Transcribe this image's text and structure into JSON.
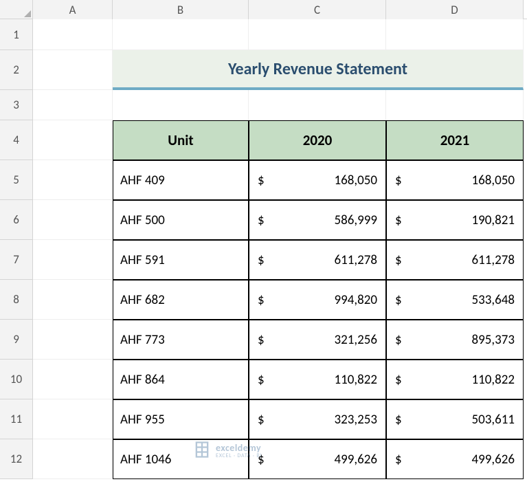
{
  "columns": [
    "A",
    "B",
    "C",
    "D"
  ],
  "rows": [
    "1",
    "2",
    "3",
    "4",
    "5",
    "6",
    "7",
    "8",
    "9",
    "10",
    "11",
    "12"
  ],
  "title": "Yearly Revenue Statement",
  "headers": {
    "unit": "Unit",
    "y1": "2020",
    "y2": "2021"
  },
  "data": [
    {
      "unit": "AHF 409",
      "y1": "168,050",
      "y2": "168,050"
    },
    {
      "unit": "AHF 500",
      "y1": "586,999",
      "y2": "190,821"
    },
    {
      "unit": "AHF 591",
      "y1": "611,278",
      "y2": "611,278"
    },
    {
      "unit": "AHF 682",
      "y1": "994,820",
      "y2": "533,648"
    },
    {
      "unit": "AHF 773",
      "y1": "321,256",
      "y2": "895,373"
    },
    {
      "unit": "AHF 864",
      "y1": "110,822",
      "y2": "110,822"
    },
    {
      "unit": "AHF 955",
      "y1": "323,253",
      "y2": "503,611"
    },
    {
      "unit": "AHF 1046",
      "y1": "499,626",
      "y2": "499,626"
    }
  ],
  "currency": "$",
  "watermark": {
    "brand": "exceldemy",
    "tag": "EXCEL · DATA · BI"
  }
}
